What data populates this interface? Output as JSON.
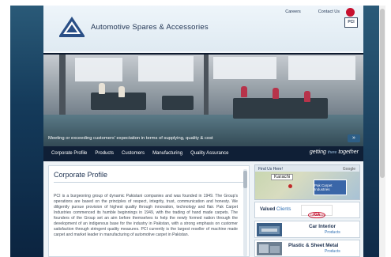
{
  "header": {
    "site_title": "Automotive Spares & Accessories",
    "logo_text": "PCI",
    "top_links": [
      "Careers",
      "Contact Us"
    ]
  },
  "hero": {
    "caption": "Meeting or exceeding customers' expectation in terms of supplying, quality & cost",
    "next_arrow": "»"
  },
  "nav": {
    "items": [
      "Corporate Profile",
      "Products",
      "Customers",
      "Manufacturing",
      "Quality Assurance"
    ],
    "tagline_left": "getting",
    "tagline_mid": "there",
    "tagline_right": "together"
  },
  "main": {
    "heading": "Corporate Profile",
    "body": "PCI is a burgeoning group of dynamic Pakistani companies and was founded in 1949. The Group's operations are based on the principles of respect, integrity, trust, communication and honesty. We diligently pursue provision of highest quality through innovation, technology and flair. Pak Carpet Industries commenced its humble beginnings in 1949, with the trading of hand made carpets. The founders of the Group set an aim before themselves to help the newly formed nation through the development of an indigenous base for the industry in Pakistan, with a strong emphasis on customer satisfaction through stringent quality measures. PCI currently is the largest reseller of machine made carpet and market leader in manufacturing of automotive carpet in Pakistan."
  },
  "sidebar": {
    "find_us": "Find Us Here!",
    "google": "Google",
    "map_city": "Karachi",
    "map_card": "Pak Carpet Industries",
    "clients_label_main": "Valued",
    "clients_label_accent": "Clients",
    "client_logo": "KIA",
    "client_logo_sub": "KIA MOTORS",
    "products": [
      {
        "name": "Car Interior",
        "link": "Products"
      },
      {
        "name": "Plastic & Sheet Metal",
        "link": "Products"
      }
    ]
  },
  "colors": {
    "navy": "#0f1f36",
    "accent_blue": "#2f6fb3",
    "flag_red": "#c8102e"
  }
}
